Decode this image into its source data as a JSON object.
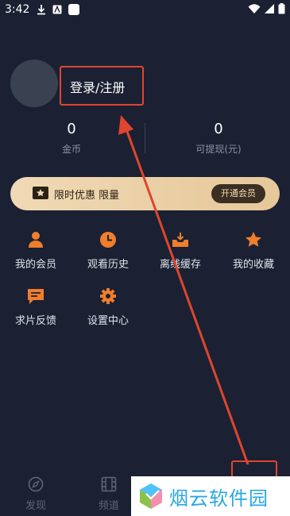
{
  "status_bar": {
    "time": "3:42"
  },
  "profile": {
    "login_label": "登录/注册"
  },
  "stats": [
    {
      "value": "0",
      "label": "金币"
    },
    {
      "value": "0",
      "label": "可提现(元)"
    }
  ],
  "vip_banner": {
    "text": "限时优惠 限量",
    "button_label": "开通会员"
  },
  "menu_items": [
    {
      "label": "我的会员",
      "icon": "person-icon"
    },
    {
      "label": "观看历史",
      "icon": "clock-icon"
    },
    {
      "label": "离线缓存",
      "icon": "download-icon"
    },
    {
      "label": "我的收藏",
      "icon": "star-icon"
    },
    {
      "label": "求片反馈",
      "icon": "chat-icon"
    },
    {
      "label": "设置中心",
      "icon": "gear-icon"
    }
  ],
  "tabbar": [
    {
      "label": "发现",
      "icon": "compass-icon"
    },
    {
      "label": "频道",
      "icon": "film-icon"
    }
  ],
  "watermark": {
    "text": "烟云软件园"
  },
  "colors": {
    "accent": "#f07e2c",
    "background": "#1b2133",
    "annotation": "#e0452e",
    "vip_gold": "#f0d9b5"
  }
}
